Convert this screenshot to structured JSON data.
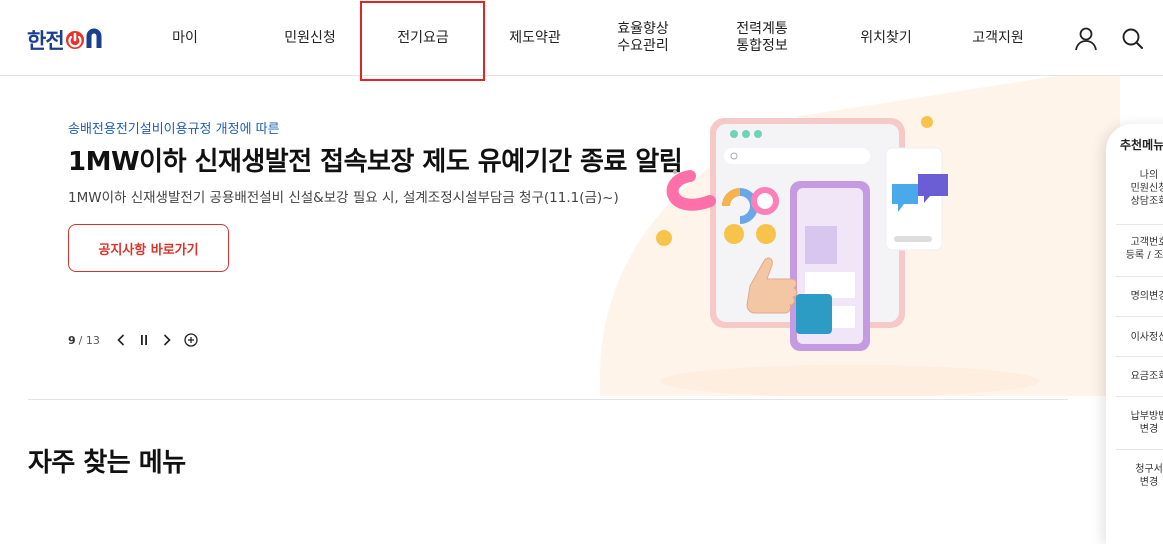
{
  "header": {
    "logo_main": "한전",
    "logo_on": "ON",
    "nav": [
      {
        "label": "마이"
      },
      {
        "label": "민원신청"
      },
      {
        "label": "전기요금"
      },
      {
        "label": "제도약관"
      },
      {
        "label": "효율향상\n수요관리"
      },
      {
        "label": "전력계통\n통합정보"
      },
      {
        "label": "위치찾기"
      },
      {
        "label": "고객지원"
      }
    ],
    "icons": {
      "user": "user-icon",
      "search": "search-icon"
    }
  },
  "hero": {
    "subtitle": "송배전용전기설비이용규정 개정에 따른",
    "title": "1MW이하 신재생발전 접속보장 제도 유예기간 종료 알림",
    "description": "1MW이하 신재생발전기 공용배전설비 신설&보강 필요 시, 설계조정시설부담금 청구(11.1(금)~)",
    "cta_label": "공지사항 바로가기",
    "pager": {
      "current": "9",
      "total": "/ 13"
    }
  },
  "section": {
    "title": "자주 찾는 메뉴"
  },
  "right_panel": {
    "title": "추천메뉴",
    "items": [
      {
        "label": "나의\n민원신청\n상담조회"
      },
      {
        "label": "고객번호\n등록 / 조회"
      },
      {
        "label": "명의변경"
      },
      {
        "label": "이사정산"
      },
      {
        "label": "요금조회"
      },
      {
        "label": "납부방법\n변경"
      },
      {
        "label": "청구서\n변경"
      }
    ]
  },
  "colors": {
    "brand_blue": "#1b3f8f",
    "brand_red": "#e5322d",
    "accent_blue": "#1f5fb8",
    "highlight_red": "#e12424"
  }
}
